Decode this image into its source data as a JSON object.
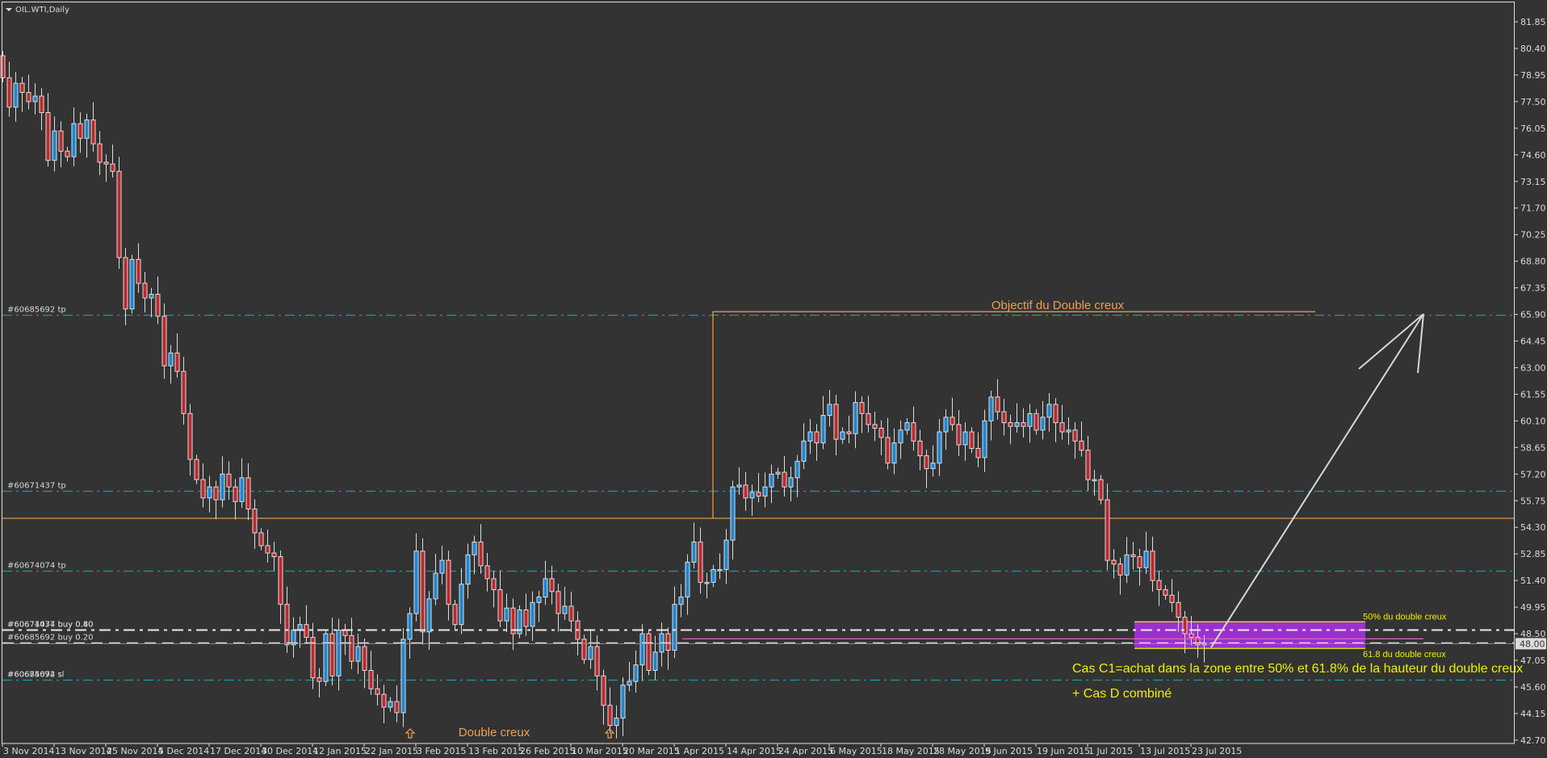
{
  "chart_title": "OIL.WTI,Daily",
  "colors": {
    "background": "#333333",
    "bull": "#1a86d6",
    "bear": "#c0262b",
    "outline": "#dddddd",
    "tp_line": "#1a9a9a",
    "orange": "#f0a050",
    "zone": "#9b30d0",
    "yellow": "#f0f000"
  },
  "chart_data": {
    "type": "candlestick",
    "symbol": "OIL.WTI",
    "timeframe": "Daily",
    "ylim": [
      42.7,
      81.85
    ],
    "y_ticks": [
      "81.85",
      "80.40",
      "78.95",
      "77.50",
      "76.05",
      "74.60",
      "73.15",
      "71.70",
      "70.25",
      "68.80",
      "67.35",
      "65.90",
      "64.45",
      "63.00",
      "61.55",
      "60.10",
      "58.65",
      "57.20",
      "55.75",
      "54.30",
      "52.85",
      "51.40",
      "49.95",
      "48.50",
      "47.05",
      "45.60",
      "44.15",
      "42.70"
    ],
    "x_ticks": [
      {
        "bar": 0,
        "label": "3 Nov 2014"
      },
      {
        "bar": 8,
        "label": "13 Nov 2014"
      },
      {
        "bar": 16,
        "label": "25 Nov 2014"
      },
      {
        "bar": 24,
        "label": "5 Dec 2014"
      },
      {
        "bar": 32,
        "label": "17 Dec 2014"
      },
      {
        "bar": 40,
        "label": "30 Dec 2014"
      },
      {
        "bar": 48,
        "label": "12 Jan 2015"
      },
      {
        "bar": 56,
        "label": "22 Jan 2015"
      },
      {
        "bar": 64,
        "label": "3 Feb 2015"
      },
      {
        "bar": 72,
        "label": "13 Feb 2015"
      },
      {
        "bar": 80,
        "label": "26 Feb 2015"
      },
      {
        "bar": 88,
        "label": "10 Mar 2015"
      },
      {
        "bar": 96,
        "label": "20 Mar 2015"
      },
      {
        "bar": 104,
        "label": "1 Apr 2015"
      },
      {
        "bar": 112,
        "label": "14 Apr 2015"
      },
      {
        "bar": 120,
        "label": "24 Apr 2015"
      },
      {
        "bar": 128,
        "label": "6 May 2015"
      },
      {
        "bar": 136,
        "label": "18 May 2015"
      },
      {
        "bar": 144,
        "label": "28 May 2015"
      },
      {
        "bar": 152,
        "label": "9 Jun 2015"
      },
      {
        "bar": 160,
        "label": "19 Jun 2015"
      },
      {
        "bar": 168,
        "label": "1 Jul 2015"
      },
      {
        "bar": 176,
        "label": "13 Jul 2015"
      },
      {
        "bar": 184,
        "label": "23 Jul 2015"
      }
    ],
    "first_open": 80.0,
    "close": [
      78.8,
      77.2,
      78.5,
      78.0,
      77.5,
      77.8,
      76.9,
      74.3,
      75.9,
      74.8,
      74.5,
      76.3,
      75.5,
      76.5,
      75.2,
      74.2,
      74.1,
      73.7,
      69.0,
      66.2,
      68.9,
      67.6,
      66.8,
      67.0,
      65.8,
      63.1,
      63.8,
      62.8,
      60.5,
      58.0,
      56.9,
      55.9,
      56.5,
      55.8,
      57.2,
      56.5,
      55.7,
      57.0,
      55.3,
      54.0,
      53.3,
      52.9,
      52.7,
      50.1,
      47.9,
      48.7,
      49.0,
      48.3,
      46.1,
      45.9,
      48.5,
      46.2,
      48.7,
      48.4,
      47.0,
      47.8,
      46.5,
      45.5,
      45.2,
      44.5,
      44.8,
      44.2,
      48.2,
      49.6,
      53.0,
      48.6,
      50.4,
      51.8,
      52.5,
      50.1,
      49.0,
      51.2,
      52.8,
      53.5,
      52.2,
      51.5,
      50.9,
      49.2,
      49.9,
      48.5,
      49.8,
      48.9,
      50.2,
      50.5,
      51.5,
      50.8,
      49.6,
      50.0,
      49.2,
      48.2,
      47.1,
      47.8,
      46.2,
      44.6,
      43.5,
      43.9,
      45.7,
      45.9,
      46.8,
      48.5,
      46.5,
      47.5,
      48.5,
      47.6,
      50.1,
      50.5,
      52.4,
      53.5,
      51.3,
      51.3,
      52.0,
      52.0,
      53.6,
      56.5,
      56.6,
      55.9,
      56.2,
      56.0,
      56.5,
      57.2,
      57.3,
      56.5,
      57.0,
      57.9,
      59.0,
      59.5,
      58.9,
      60.4,
      61.0,
      59.1,
      59.5,
      59.4,
      61.1,
      60.5,
      59.9,
      59.7,
      59.2,
      57.8,
      58.9,
      59.6,
      60.0,
      59.0,
      58.2,
      57.5,
      57.8,
      59.5,
      60.3,
      59.9,
      58.8,
      59.5,
      58.6,
      58.1,
      60.1,
      61.4,
      60.6,
      60.0,
      59.8,
      60.0,
      59.8,
      60.5,
      59.6,
      60.3,
      61.0,
      60.0,
      59.5,
      59.6,
      59.0,
      58.5,
      56.9,
      56.9,
      55.8,
      52.5,
      52.3,
      51.7,
      52.8,
      52.7,
      52.1,
      53.0,
      51.4,
      50.9,
      50.6,
      50.2,
      49.4,
      48.5,
      48.3,
      47.9,
      48.0
    ],
    "current_price": "48.00",
    "order_lines": [
      {
        "label": "#60685692 tp",
        "price": 65.9,
        "style": "tp"
      },
      {
        "label": "#60671437 tp",
        "price": 56.29,
        "style": "tp"
      },
      {
        "label": "#60674074 tp",
        "price": 51.93,
        "style": "tp"
      },
      {
        "label": "#60674074 buy 0.80",
        "label2": "#60671437 buy 0.40",
        "price": 48.72,
        "style": "buy"
      },
      {
        "label": "#60685692 buy 0.20",
        "price": 48.02,
        "style": "buy2"
      },
      {
        "label": "#60685692 sl",
        "label2": "#60674074 sl",
        "price": 45.99,
        "style": "tp"
      }
    ],
    "neckline_price": 54.79,
    "target_price": 66.05,
    "zone": {
      "top": 49.15,
      "bottom": 47.7,
      "upper_label": "50% du double creux",
      "lower_label": "61.8 du double creux"
    },
    "pink_line_price": 48.22,
    "annotations": {
      "target": "Objectif du Double creux",
      "pattern": "Double creux",
      "case": "Cas C1=achat dans la zone entre 50% et 61.8% de la hauteur du double creux",
      "case2": "+ Cas D combiné"
    }
  }
}
